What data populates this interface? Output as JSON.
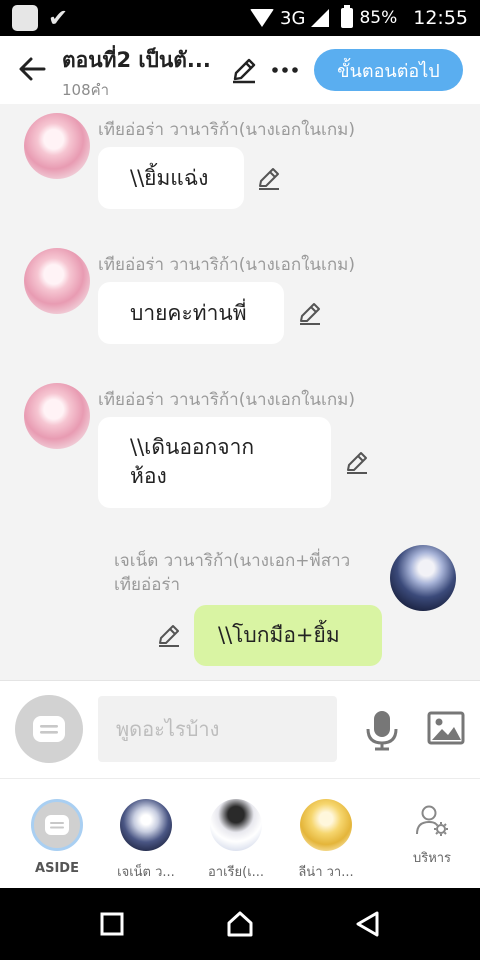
{
  "status_bar": {
    "network": "3G",
    "battery": "85%",
    "time": "12:55"
  },
  "header": {
    "title": "ตอนที่2 เป็นตั...",
    "word_count": "108คำ",
    "next_button": "ขั้นตอนต่อไป"
  },
  "messages": [
    {
      "sender": "เทียอ่อร่า วานาริก้า(นางเอกในเกม)",
      "text": "\\\\ยิ้มแฉ่ง",
      "avatar": "pink-character-avatar"
    },
    {
      "sender": "เทียอ่อร่า วานาริก้า(นางเอกในเกม)",
      "text": "บายคะท่านพี่",
      "avatar": "pink-character-avatar"
    },
    {
      "sender": "เทียอ่อร่า วานาริก้า(นางเอกในเกม)",
      "text": "\\\\เดินออกจาก\nห้อง",
      "avatar": "pink-character-avatar"
    },
    {
      "sender": "เจเน็ต วานาริก้า(นางเอก+พี่สาว\nเทียอ่อร่า",
      "text": "\\\\โบกมือ+ยิ้ม",
      "avatar": "dark-character-avatar"
    }
  ],
  "input": {
    "placeholder": "พูดอะไรบ้าง"
  },
  "characters": [
    {
      "label": "ASIDE"
    },
    {
      "label": "เจเน็ต ว..."
    },
    {
      "label": "อาเรีย(เ..."
    },
    {
      "label": "ลีน่า วา..."
    },
    {
      "label": "บริหาร"
    }
  ],
  "colors": {
    "accent": "#5aaef0",
    "own_bubble": "#d9f4a3",
    "bubble": "#ffffff",
    "background": "#f3f3f3"
  }
}
